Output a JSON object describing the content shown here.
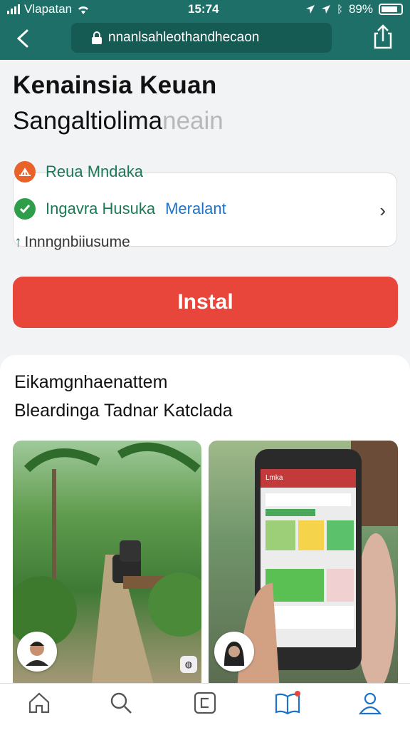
{
  "status": {
    "carrier": "Vlapatan",
    "time": "15:74",
    "battery": "89%"
  },
  "browser": {
    "url": "nnanlsahleothandhecaon"
  },
  "app": {
    "title_line1": "Kenainsia Keuan",
    "title_line2_main": "Sangaltiolima",
    "title_line2_faded": "neain",
    "developer": "Reua Mndaka",
    "badge_label": "Ingavra Husuka",
    "badge_status": "Meralant",
    "downloads": "Innngnbiiusume",
    "install_label": "Instal"
  },
  "panel": {
    "title": "Eikamgnhaenattem",
    "subtitle": "Bleardinga Tadnar Katclada"
  },
  "screenshot2": {
    "app_header": "Lmka"
  },
  "colors": {
    "accent": "#1e6f67",
    "install": "#e8463a",
    "verified": "#1c73c9",
    "green": "#1b7a55"
  },
  "icons": [
    "back-icon",
    "lock-icon",
    "share-icon",
    "home-icon",
    "search-icon",
    "apps-icon",
    "book-icon",
    "profile-icon"
  ]
}
